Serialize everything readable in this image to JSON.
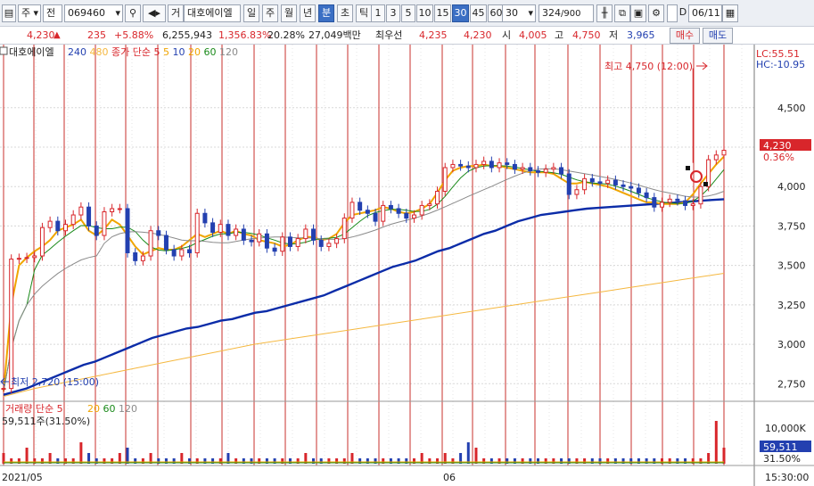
{
  "toolbar": {
    "market_sel": "주",
    "type_sel": "전",
    "code": "069460",
    "company_btn": "거",
    "company_name": "대호에이엘",
    "periods": [
      "일",
      "주",
      "월",
      "년",
      "분",
      "초",
      "틱"
    ],
    "active_period": "분",
    "intervals": [
      "1",
      "3",
      "5",
      "10",
      "15",
      "30",
      "45",
      "60"
    ],
    "active_interval": "30",
    "interval_value": "30",
    "count": "324",
    "count_total": "/900",
    "d_label": "D",
    "date": "06/11"
  },
  "quote": {
    "price": "4,230",
    "change": "235",
    "change_pct": "+5.88%",
    "volume": "6,255,943",
    "vol_ratio": "1,356.83%",
    "turnover": "20.28%",
    "amount": "27,049백만",
    "best_ask_label": "최우선",
    "best_ask": "4,235",
    "best_bid": "4,230",
    "open_label": "시",
    "open": "4,005",
    "high_label": "고",
    "high": "4,750",
    "low_label": "저",
    "low": "3,965",
    "buy_label": "매수",
    "sell_label": "매도"
  },
  "chart_data": {
    "type": "line",
    "price_legend": {
      "name": "대호에이엘",
      "ma_label": "종가 단순 5",
      "periods": [
        "240",
        "480",
        "5",
        "10",
        "20",
        "60",
        "120"
      ]
    },
    "volume_legend": {
      "name": "거래량 단순 5",
      "periods": [
        "20",
        "60",
        "120"
      ],
      "value": "59,511주(31.50%)"
    },
    "lc": "LC:55.51",
    "hc": "HC:-10.95",
    "y_ticks": [
      "4,500",
      "4,250",
      "4,000",
      "3,750",
      "3,500",
      "3,250",
      "3,000",
      "2,750"
    ],
    "ylim": [
      2650,
      4900
    ],
    "vol_tick": "10,000K",
    "current_price_label": "4,230",
    "current_pct_label": "0.36%",
    "current_volume_label": "59,511",
    "current_volume_pct": "31.50%",
    "x_labels": [
      "2021/05",
      "06"
    ],
    "time_label": "15:30:00",
    "high_annotation": "최고 4,750 (12:00)",
    "low_annotation": "최저 2,720 (15:00)",
    "close": [
      2720,
      3540,
      3545,
      3550,
      3560,
      3740,
      3780,
      3720,
      3760,
      3820,
      3870,
      3750,
      3690,
      3840,
      3860,
      3860,
      3580,
      3530,
      3560,
      3720,
      3690,
      3600,
      3560,
      3600,
      3580,
      3830,
      3770,
      3710,
      3760,
      3690,
      3730,
      3660,
      3650,
      3700,
      3610,
      3590,
      3680,
      3620,
      3670,
      3730,
      3660,
      3620,
      3640,
      3670,
      3800,
      3900,
      3850,
      3830,
      3780,
      3880,
      3860,
      3830,
      3800,
      3820,
      3880,
      3890,
      3970,
      4120,
      4140,
      4130,
      4120,
      4140,
      4160,
      4120,
      4150,
      4140,
      4110,
      4120,
      4100,
      4090,
      4110,
      4120,
      4080,
      3950,
      3980,
      4050,
      4030,
      4020,
      4040,
      4010,
      4000,
      3990,
      3960,
      3930,
      3870,
      3900,
      3920,
      3910,
      3880,
      3890,
      4000,
      4170,
      4200,
      4230
    ],
    "ma5": [
      2700,
      3250,
      3500,
      3550,
      3590,
      3620,
      3660,
      3720,
      3740,
      3760,
      3790,
      3720,
      3690,
      3730,
      3790,
      3760,
      3690,
      3620,
      3570,
      3590,
      3610,
      3600,
      3600,
      3620,
      3660,
      3700,
      3680,
      3700,
      3720,
      3700,
      3720,
      3700,
      3690,
      3660,
      3650,
      3640,
      3620,
      3630,
      3660,
      3680,
      3680,
      3660,
      3670,
      3700,
      3770,
      3820,
      3830,
      3840,
      3850,
      3870,
      3860,
      3840,
      3830,
      3840,
      3860,
      3890,
      3960,
      4040,
      4100,
      4120,
      4130,
      4130,
      4140,
      4130,
      4130,
      4120,
      4110,
      4100,
      4090,
      4090,
      4090,
      4080,
      4050,
      4020,
      4020,
      4030,
      4020,
      4010,
      4000,
      3980,
      3960,
      3940,
      3920,
      3900,
      3900,
      3890,
      3890,
      3890,
      3900,
      3950,
      4020,
      4080,
      4140,
      4190
    ],
    "ma240": [
      2680,
      2700,
      2720,
      2750,
      2780,
      2810,
      2840,
      2870,
      2890,
      2920,
      2950,
      2980,
      3010,
      3040,
      3060,
      3080,
      3100,
      3110,
      3130,
      3150,
      3160,
      3180,
      3200,
      3210,
      3230,
      3250,
      3270,
      3290,
      3310,
      3340,
      3370,
      3400,
      3430,
      3460,
      3490,
      3510,
      3530,
      3560,
      3590,
      3610,
      3640,
      3670,
      3700,
      3720,
      3750,
      3780,
      3800,
      3820,
      3830,
      3840,
      3850,
      3860,
      3865,
      3870,
      3875,
      3880,
      3885,
      3890,
      3895,
      3900,
      3905,
      3910,
      3915,
      3920
    ],
    "ma480": [
      2670,
      2720,
      2760,
      2800,
      2840,
      2880,
      2920,
      2960,
      3000,
      3030,
      3060,
      3090,
      3120,
      3150,
      3180,
      3210,
      3240,
      3270,
      3300,
      3330,
      3360,
      3390,
      3420,
      3450
    ],
    "volume": [
      2,
      1,
      1,
      3,
      1,
      1,
      2,
      1,
      1,
      1,
      4,
      2,
      1,
      1,
      1,
      2,
      3,
      1,
      1,
      2,
      1,
      1,
      1,
      2,
      1,
      1,
      1,
      1,
      1,
      2,
      1,
      1,
      1,
      1,
      1,
      1,
      1,
      1,
      1,
      2,
      1,
      1,
      1,
      1,
      1,
      2,
      1,
      1,
      1,
      1,
      1,
      1,
      1,
      1,
      2,
      1,
      1,
      2,
      1,
      2,
      4,
      3,
      1,
      1,
      1,
      1,
      1,
      1,
      1,
      1,
      1,
      1,
      1,
      1,
      1,
      1,
      1,
      1,
      1,
      1,
      1,
      1,
      1,
      1,
      1,
      1,
      1,
      1,
      1,
      1,
      1,
      2,
      8,
      3
    ],
    "colors": {
      "up": "#d8262b",
      "down": "#2340b0",
      "ma5": "#f0a500",
      "ma10": "#1a8a1a",
      "ma240": "#0b2ca8",
      "ma480": "#f5b840",
      "ma120": "#8a8a8a",
      "vline": "#c8322c"
    }
  }
}
